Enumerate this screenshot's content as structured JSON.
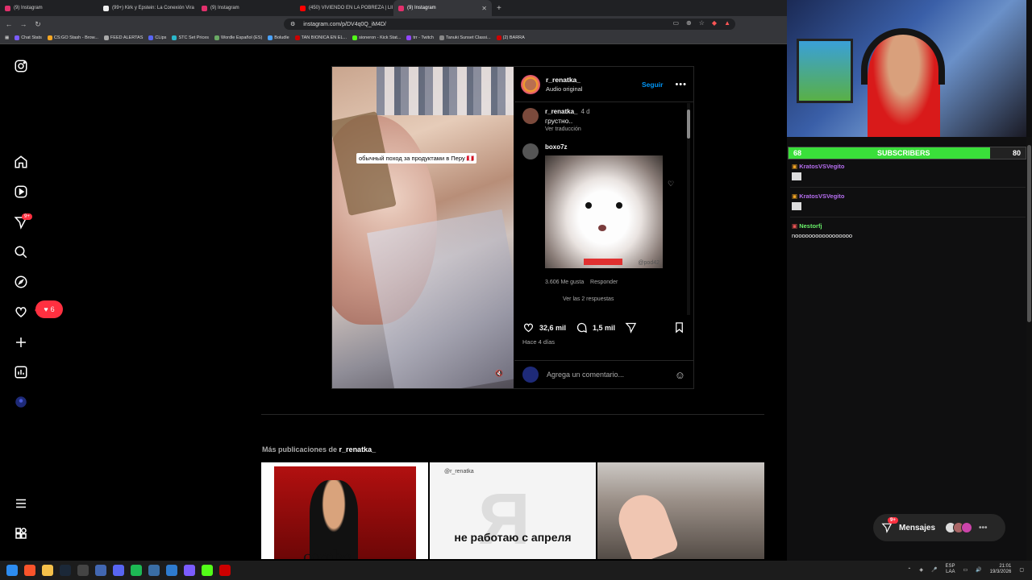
{
  "browser": {
    "tabs": [
      {
        "label": "(9) Instagram",
        "color": "#e1306c",
        "active": false
      },
      {
        "label": "(99+) Kirk y Epstein: La Conexión Vira",
        "color": "#000000",
        "active": false
      },
      {
        "label": "(9) Instagram",
        "color": "#e1306c",
        "active": false
      },
      {
        "label": "(450) VIVIENDO EN LA POBREZA | Lll",
        "color": "#ff0000",
        "active": false
      },
      {
        "label": "(9) Instagram",
        "color": "#e1306c",
        "active": true
      }
    ],
    "url": "instagram.com/p/DV4q0Q_iM4D/",
    "bookmarks": [
      "Chat Stats",
      "CS:GO Stash - Brow...",
      "FEED ALERTAS",
      "CLips",
      "STC Set Prices",
      "Wordle Español (ES)",
      "Boludle",
      "TAN BIONICA EN EL...",
      "sioneron - Kick Stat...",
      "trr - Twitch",
      "Tanuki Sunset Classi...",
      "(2) BARRA"
    ]
  },
  "sidebar": {
    "icons": [
      "instagram-icon",
      "home-icon",
      "reels-icon",
      "messages-icon",
      "search-icon",
      "explore-icon",
      "notifications-icon",
      "create-icon",
      "dashboard-icon",
      "profile-icon",
      "menu-icon",
      "more-icon"
    ],
    "messages_badge": "9+",
    "notifications_count": "6"
  },
  "post": {
    "overlay_caption": "обычный поход за продуктами в Перу 🇵🇪",
    "author": "r_renatka_",
    "audio": "Audio original",
    "follow": "Seguir",
    "comments": [
      {
        "user": "r_renatka_",
        "time": "4 d",
        "text": "грустно..",
        "meta": "Ver traducción"
      },
      {
        "user": "boxo7z",
        "gif_watermark": "@pod42",
        "likes": "3.606 Me gusta",
        "reply": "Responder",
        "replies": "Ver las 2 respuestas"
      }
    ],
    "likes": "32,6 mil",
    "comments_count": "1,5 mil",
    "posted": "Hace 4 días",
    "add_comment_placeholder": "Agrega un comentario..."
  },
  "more_posts": {
    "label": "Más publicaciones de",
    "user": "r_renatka_",
    "tiles": [
      {
        "text": "combo"
      },
      {
        "handle": "@r_renatka",
        "letter": "Я",
        "text": "не работаю с апреля"
      },
      {
        "text": ""
      }
    ]
  },
  "stream": {
    "subs_current": "68",
    "subs_label": "SUBSCRIBERS",
    "subs_goal": "80",
    "subs_progress": 0.85,
    "chat": [
      {
        "user": "KratosVSVegito",
        "text": ""
      },
      {
        "user": "KratosVSVegito",
        "text": ""
      },
      {
        "user": "Nestorfj",
        "text": "nooooooooooooooooo"
      }
    ]
  },
  "messages_bar": {
    "label": "Mensajes",
    "badge": "9+"
  },
  "taskbar": {
    "lang": "ESP",
    "layout": "LAA",
    "time": "21:01",
    "date": "19/3/2026"
  }
}
